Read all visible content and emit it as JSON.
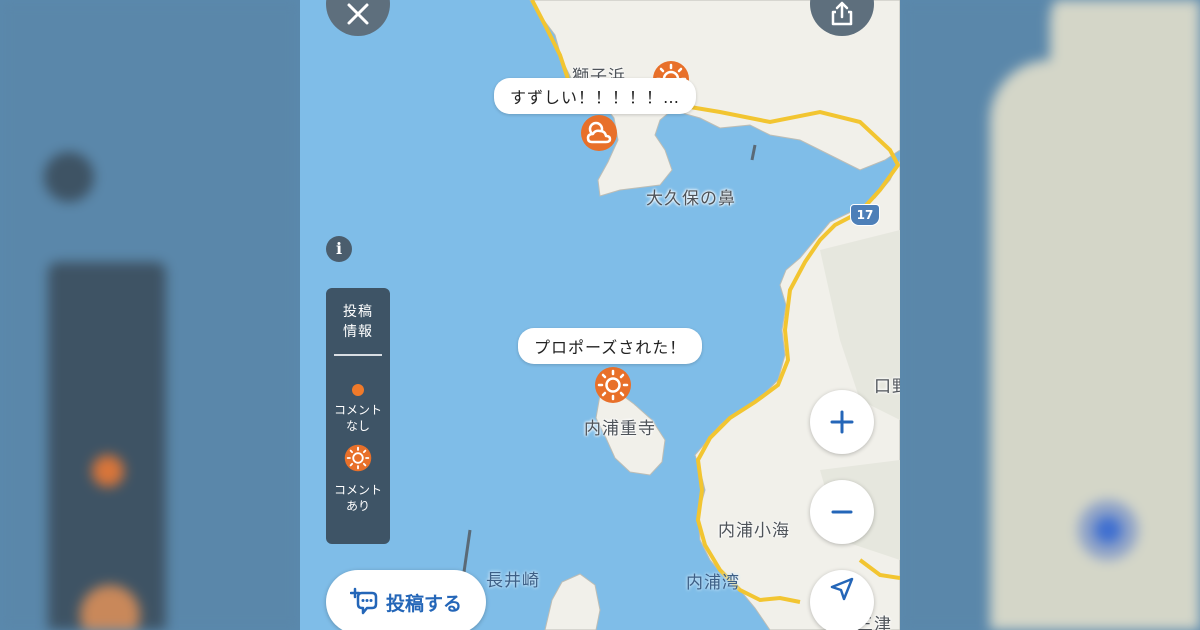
{
  "map": {
    "places": {
      "shishigahama": "獅子浜",
      "ookubo_no_hana": "大久保の鼻",
      "uchiura_shigedera": "内浦重寺",
      "uchiura_kogai": "内浦小海",
      "nagaizaki": "長井崎",
      "uchiura_wan": "内浦湾",
      "kuchino": "口野",
      "mitsu": "三津"
    },
    "route_number": "17"
  },
  "posts": [
    {
      "comment": "すずしい！！！！！…",
      "weather_icon": "sun-cloud-icon"
    },
    {
      "comment": "プロポーズされた！",
      "weather_icon": "sun-icon"
    }
  ],
  "legend": {
    "title": "投稿\n情報",
    "no_comment_label": "コメント\nなし",
    "with_comment_label": "コメント\nあり",
    "marker_color": "#f07a2a"
  },
  "buttons": {
    "post_label": "投稿する"
  },
  "colors": {
    "sea": "#7fbde8",
    "land": "#f1f0ea",
    "road": "#f2c531",
    "panel": "#3e5466",
    "accent_blue": "#2466b8"
  }
}
